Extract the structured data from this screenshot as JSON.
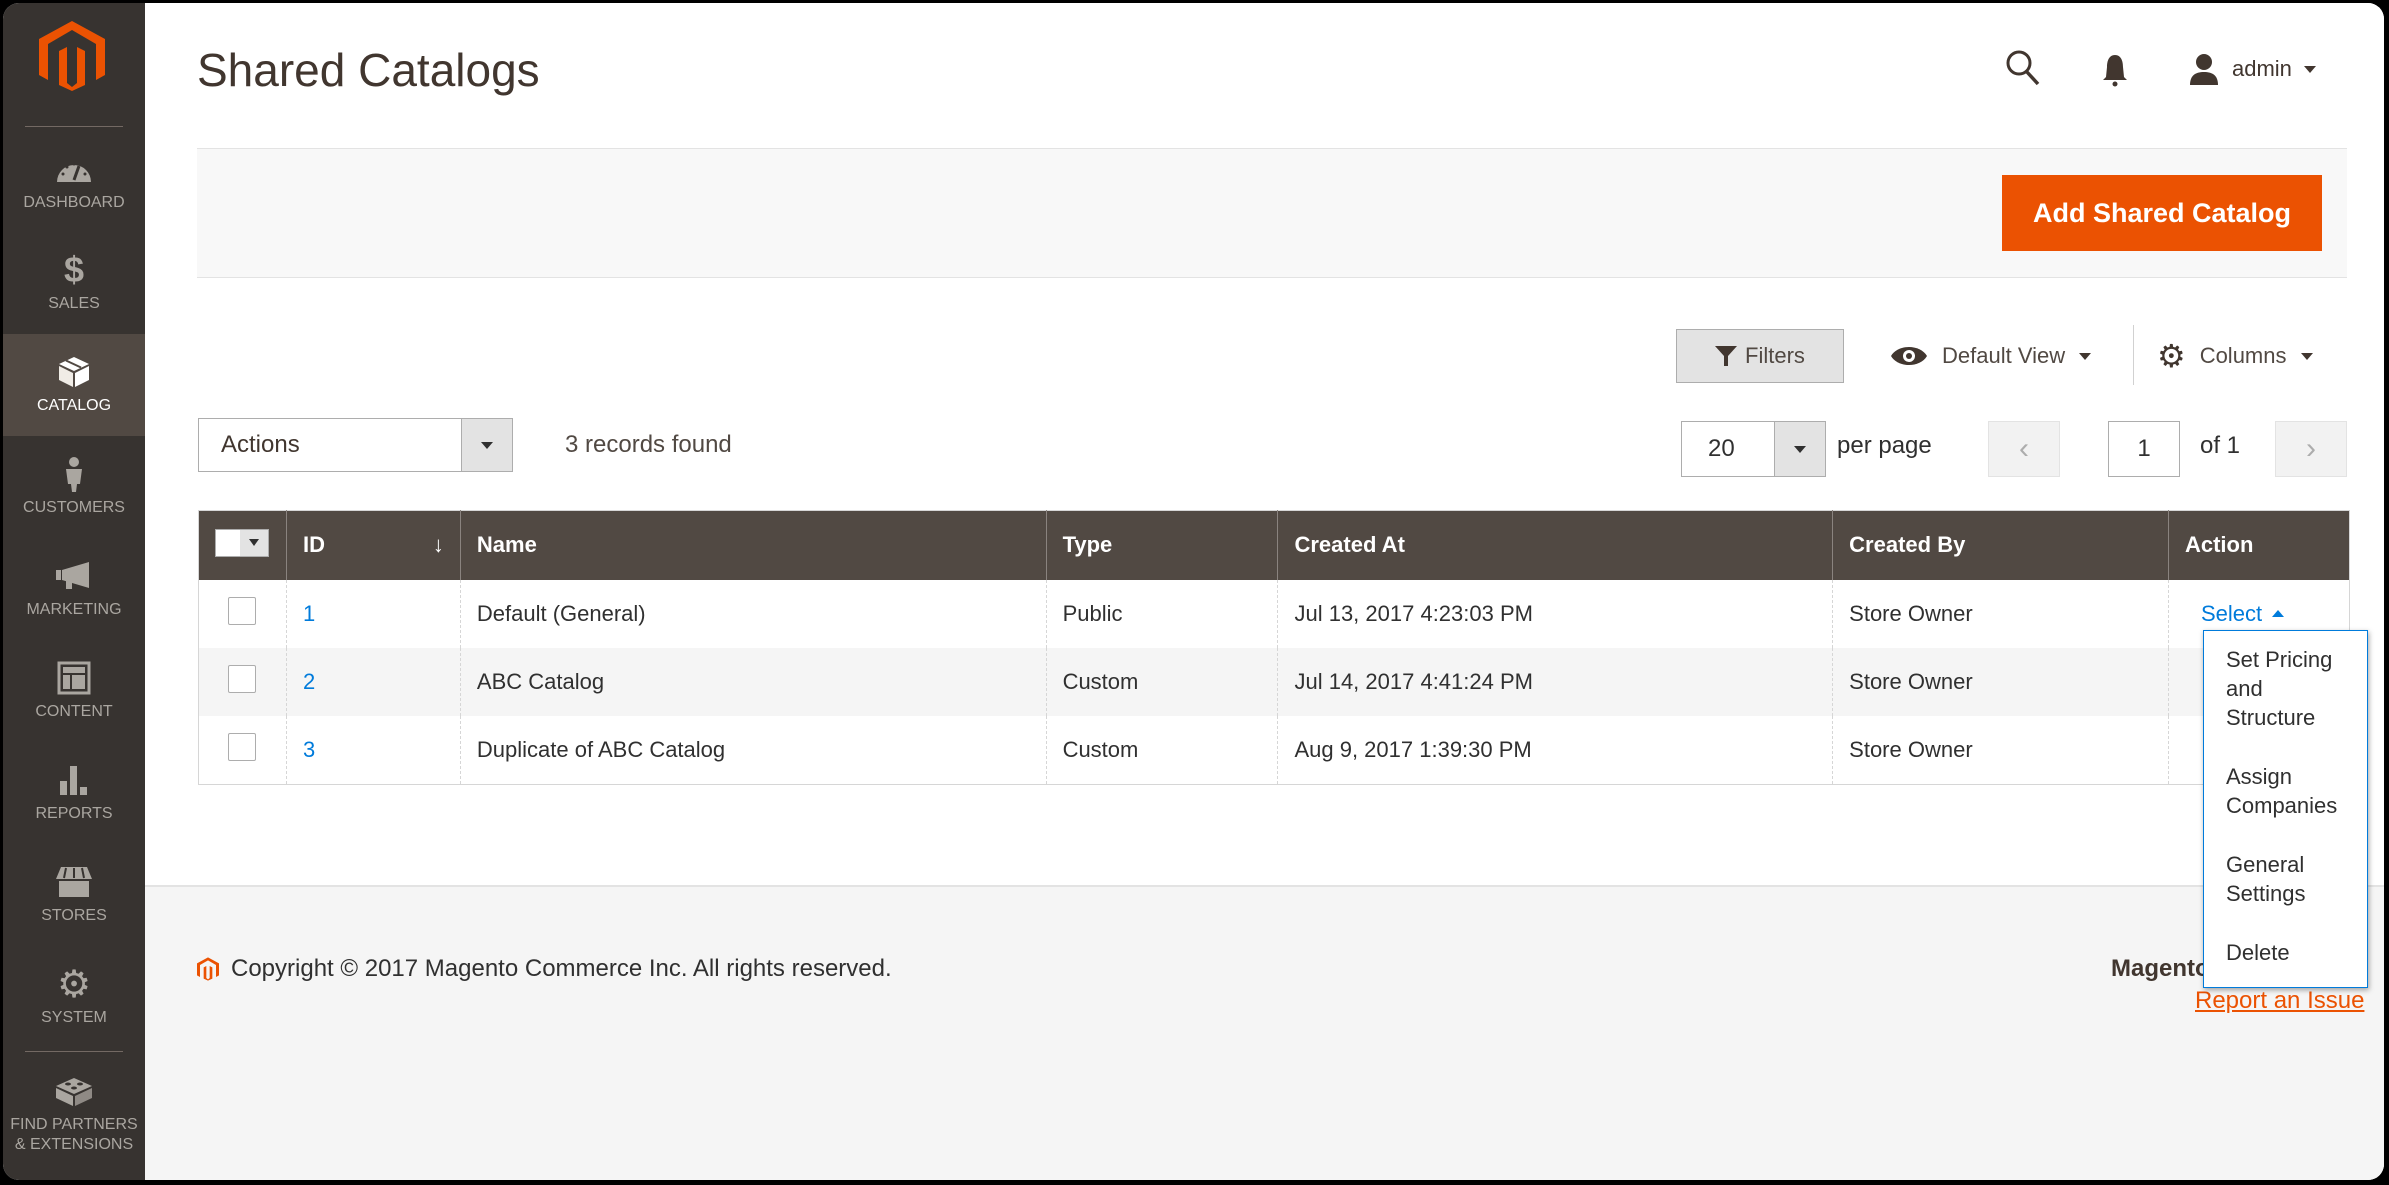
{
  "sidebar": {
    "items": [
      {
        "label": "Dashboard",
        "icon": "dashboard-icon",
        "active": false
      },
      {
        "label": "Sales",
        "icon": "dollar-icon",
        "active": false
      },
      {
        "label": "Catalog",
        "icon": "box-icon",
        "active": true
      },
      {
        "label": "Customers",
        "icon": "person-icon",
        "active": false
      },
      {
        "label": "Marketing",
        "icon": "megaphone-icon",
        "active": false
      },
      {
        "label": "Content",
        "icon": "layout-icon",
        "active": false
      },
      {
        "label": "Reports",
        "icon": "bar-chart-icon",
        "active": false
      },
      {
        "label": "Stores",
        "icon": "storefront-icon",
        "active": false
      },
      {
        "label": "System",
        "icon": "gear-icon",
        "active": false
      },
      {
        "label": "Find Partners & Extensions",
        "icon": "lego-brick-icon",
        "active": false
      }
    ]
  },
  "header": {
    "title": "Shared Catalogs",
    "user": "admin"
  },
  "page_actions": {
    "add_button": "Add Shared Catalog"
  },
  "toolbar": {
    "filters": "Filters",
    "view": "Default View",
    "columns": "Columns",
    "mass_actions": "Actions",
    "records_found": "3 records found",
    "per_page_value": "20",
    "per_page_label": "per page",
    "current_page": "1",
    "page_total": "of 1"
  },
  "table": {
    "headers": [
      "ID",
      "Name",
      "Type",
      "Created At",
      "Created By",
      "Action"
    ],
    "sort_indicator": "↓",
    "rows": [
      {
        "id": "1",
        "name": "Default (General)",
        "type": "Public",
        "created_at": "Jul 13, 2017 4:23:03 PM",
        "created_by": "Store Owner",
        "action": "Select"
      },
      {
        "id": "2",
        "name": "ABC Catalog",
        "type": "Custom",
        "created_at": "Jul 14, 2017 4:41:24 PM",
        "created_by": "Store Owner",
        "action": ""
      },
      {
        "id": "3",
        "name": "Duplicate of ABC Catalog",
        "type": "Custom",
        "created_at": "Aug 9, 2017 1:39:30 PM",
        "created_by": "Store Owner",
        "action": ""
      }
    ],
    "action_menu": [
      "Set Pricing and Structure",
      "Assign Companies",
      "General Settings",
      "Delete"
    ]
  },
  "footer": {
    "copyright": "Copyright © 2017 Magento Commerce Inc. All rights reserved.",
    "brand": "Magento",
    "report_link": "Report an Issue"
  },
  "colors": {
    "accent": "#eb5202",
    "sidebar_bg": "#373330",
    "sidebar_active": "#514943",
    "table_header": "#514943",
    "link": "#007bdb"
  }
}
